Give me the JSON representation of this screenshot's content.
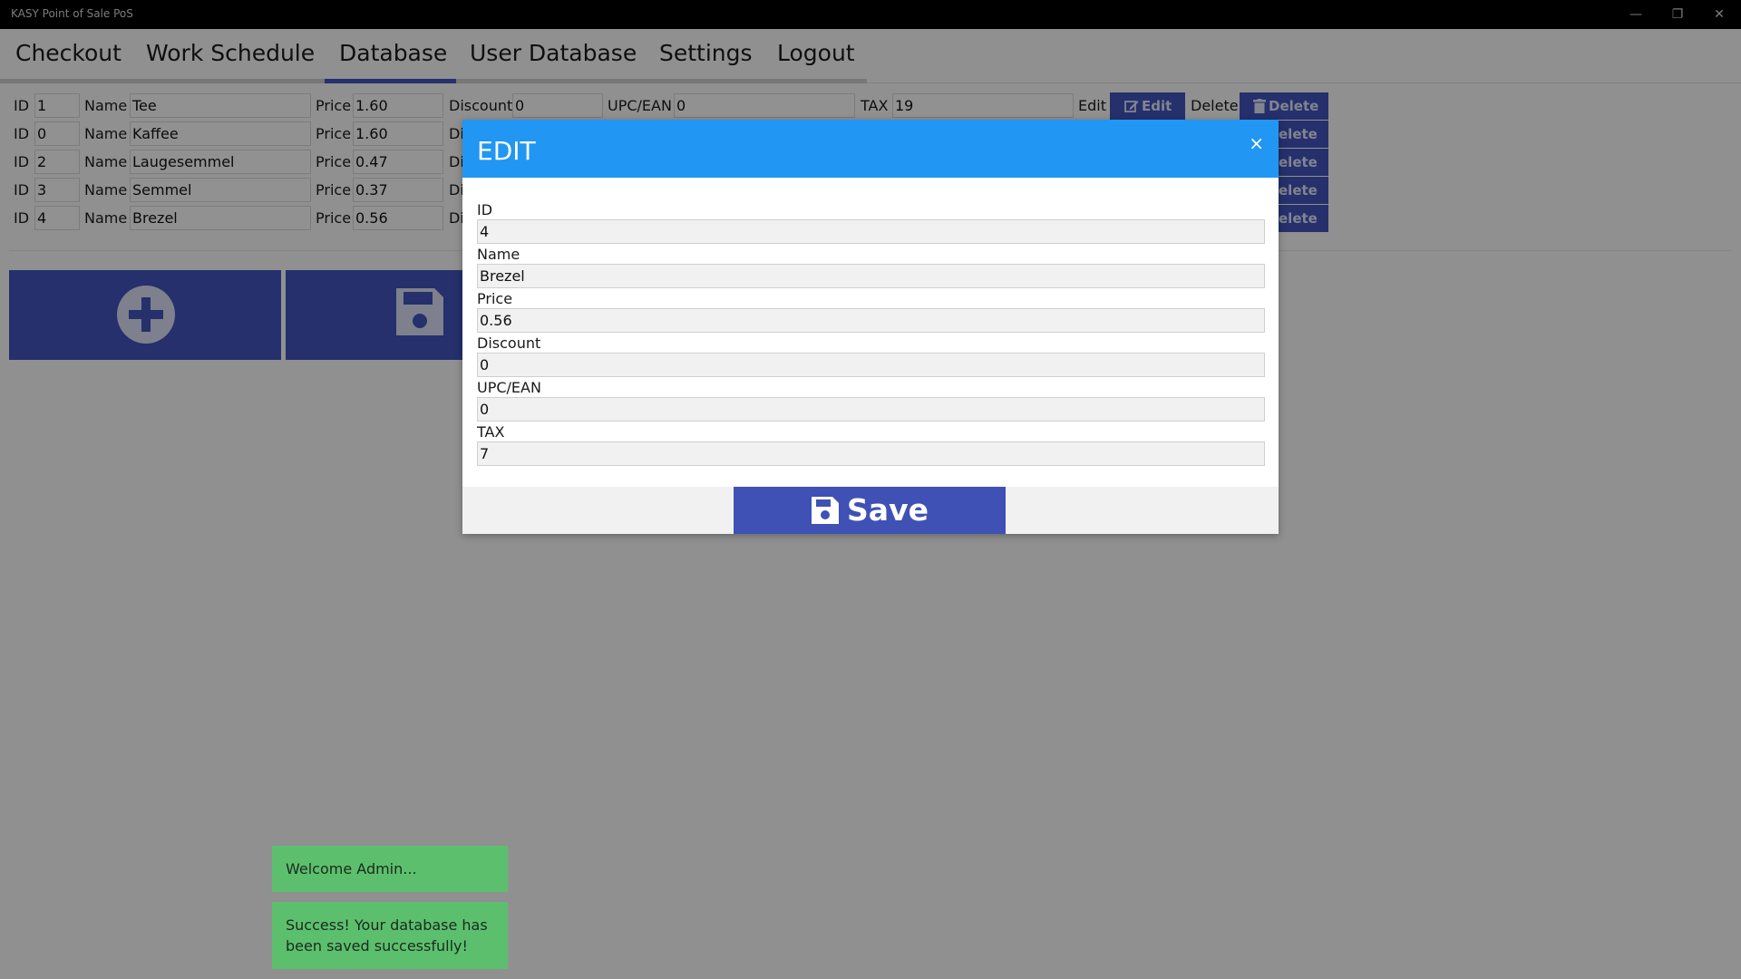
{
  "window": {
    "title": "KASY Point of Sale PoS",
    "minimize": "—",
    "restore": "❐",
    "close": "✕"
  },
  "nav": {
    "tabs": [
      "Checkout",
      "Work Schedule",
      "Database",
      "User Database",
      "Settings",
      "Logout"
    ],
    "active_tab": "Database"
  },
  "labels": {
    "id": "ID",
    "name": "Name",
    "price": "Price",
    "discount": "Discount",
    "upc": "UPC/EAN",
    "tax": "TAX",
    "edit": "Edit",
    "delete": "Delete"
  },
  "rows": [
    {
      "id": "1",
      "name": "Tee",
      "price": "1.60",
      "discount": "0",
      "upc": "0",
      "tax": "19",
      "edit_btn": "Edit",
      "delete_btn": "Delete"
    },
    {
      "id": "0",
      "name": "Kaffee",
      "price": "1.60",
      "discount": "Di",
      "delete_btn": "elete"
    },
    {
      "id": "2",
      "name": "Laugesemmel",
      "price": "0.47",
      "discount": "Di",
      "delete_btn": "elete"
    },
    {
      "id": "3",
      "name": "Semmel",
      "price": "0.37",
      "discount": "Di",
      "delete_btn": "elete"
    },
    {
      "id": "4",
      "name": "Brezel",
      "price": "0.56",
      "discount": "Di",
      "delete_btn": "elete"
    }
  ],
  "modal": {
    "title": "EDIT",
    "close": "×",
    "fields": [
      {
        "label": "ID",
        "value": "4"
      },
      {
        "label": "Name",
        "value": "Brezel"
      },
      {
        "label": "Price",
        "value": "0.56"
      },
      {
        "label": "Discount",
        "value": "0"
      },
      {
        "label": "UPC/EAN",
        "value": "0"
      },
      {
        "label": "TAX",
        "value": "7"
      }
    ],
    "save_label": "Save"
  },
  "toasts": [
    "Welcome Admin...",
    "Success! Your database has been saved successfully!"
  ],
  "colors": {
    "primary": "#3f51b5",
    "modal_header": "#2196f3",
    "toast": "#5cbf6e"
  },
  "icons": {
    "add": "plus-circle-icon",
    "save": "floppy-disk-icon",
    "edit": "edit-icon",
    "delete": "trash-icon"
  }
}
